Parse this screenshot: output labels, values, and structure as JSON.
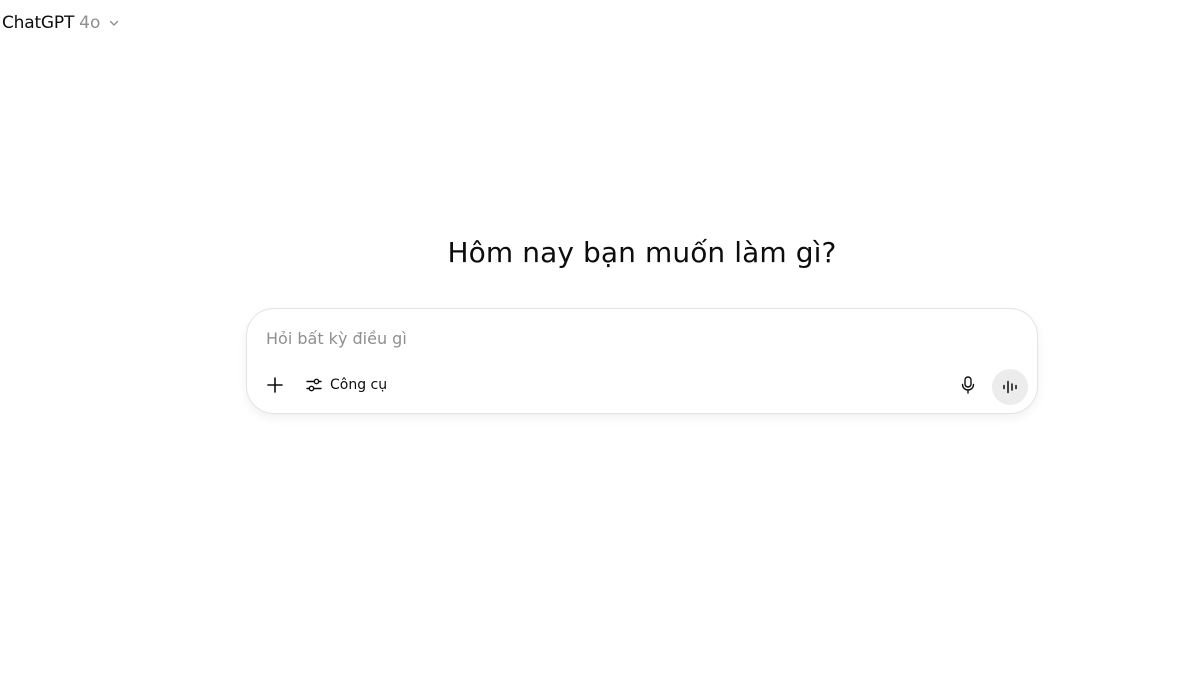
{
  "header": {
    "model_name": "ChatGPT",
    "model_version": "4o"
  },
  "main": {
    "heading": "Hôm nay bạn muốn làm gì?"
  },
  "composer": {
    "placeholder": "Hỏi bất kỳ điều gì",
    "value": "",
    "tools_label": "Công cụ",
    "icons": {
      "attach": "plus-icon",
      "tools": "sliders-icon",
      "dictate": "microphone-icon",
      "voice": "voice-waveform-icon",
      "model_menu": "chevron-down-icon"
    }
  },
  "colors": {
    "text": "#0d0d0d",
    "muted": "#8f8f8f",
    "border": "#e3e3e3",
    "voice_button_bg": "#ececec",
    "background": "#ffffff"
  }
}
